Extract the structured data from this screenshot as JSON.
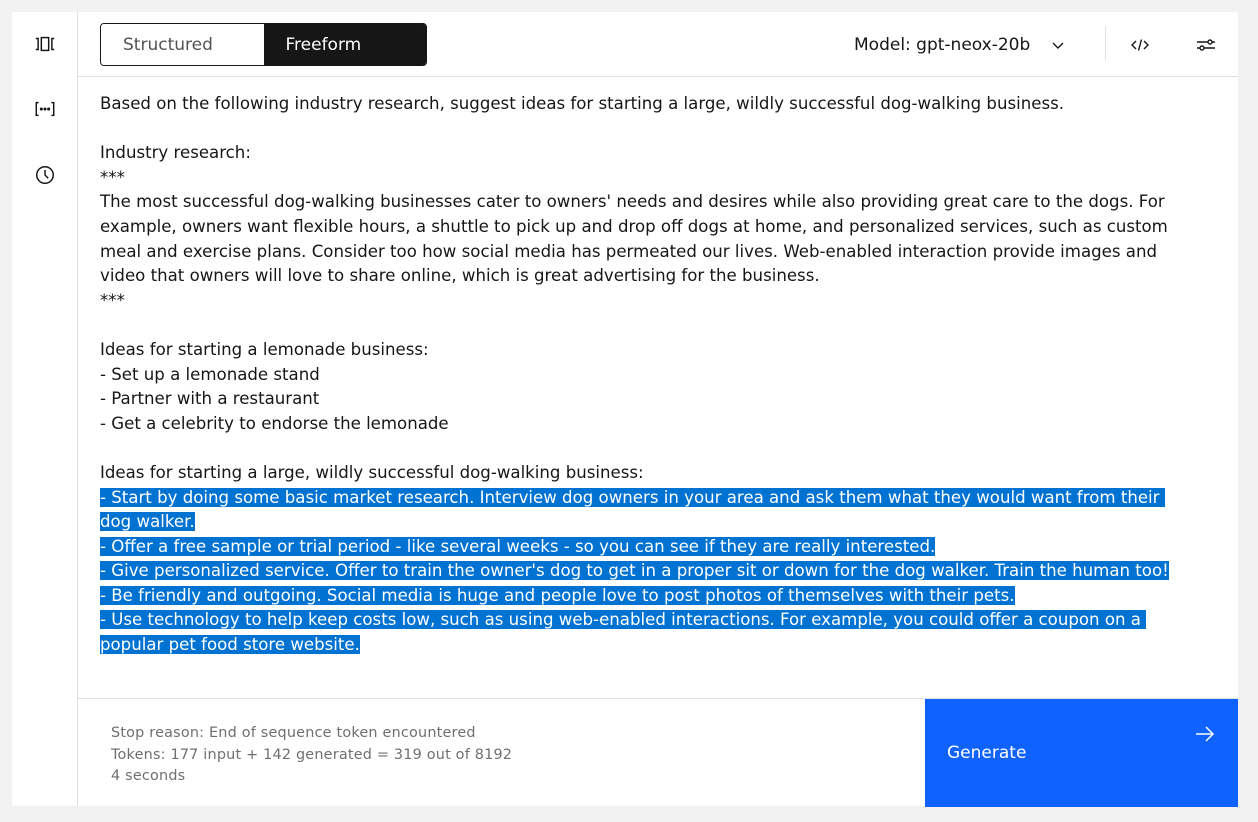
{
  "sidebar": {
    "items": [
      {
        "name": "carousel",
        "icon": "carousel-icon"
      },
      {
        "name": "variables",
        "icon": "bracket-dots-icon"
      },
      {
        "name": "history",
        "icon": "clock-icon"
      }
    ]
  },
  "header": {
    "mode_toggle": {
      "options": [
        "Structured",
        "Freeform"
      ],
      "selected": "Freeform"
    },
    "model": {
      "label": "Model: gpt-neox-20b",
      "icon": "chevron-down-icon"
    },
    "code_icon": "code-icon",
    "settings_icon": "sliders-icon"
  },
  "editor": {
    "prompt_lines": [
      "Based on the following industry research, suggest ideas for starting a large, wildly successful dog-walking business.",
      "",
      "Industry research:",
      "***",
      "The most successful dog-walking businesses cater to owners' needs and desires while also providing great care to the dogs. For example, owners want flexible hours, a shuttle to pick up and drop off dogs at home, and personalized services, such as custom meal and exercise plans. Consider too how social media has permeated our lives. Web-enabled interaction provide images and video that owners will love to share online, which is great advertising for the business.",
      "***",
      "",
      "Ideas for starting a lemonade business:",
      "- Set up a lemonade stand",
      "- Partner with a restaurant",
      "- Get a celebrity to endorse the lemonade",
      "",
      "Ideas for starting a large, wildly successful dog-walking business:"
    ],
    "generated_lines": [
      "- Start by doing some basic market research. Interview dog owners in your area and ask them what they would want from their dog walker.",
      "- Offer a free sample or trial period - like several weeks - so you can see if they are really interested.",
      "- Give personalized service. Offer to train the owner's dog to get in a proper sit or down for the dog walker. Train the human too!",
      "- Be friendly and outgoing. Social media is huge and people love to post photos of themselves with their pets.",
      "- Use technology to help keep costs low, such as using web-enabled interactions. For example, you could offer a coupon on a popular pet food store website."
    ]
  },
  "footer": {
    "stop_reason": "Stop reason: End of sequence token encountered",
    "tokens": "Tokens: 177 input + 142 generated = 319 out of 8192",
    "duration": "4 seconds",
    "generate_label": "Generate",
    "generate_icon": "arrow-right-icon"
  },
  "colors": {
    "accent": "#0f62fe",
    "selection": "#0072d2",
    "toggle_active": "#161616",
    "muted_text": "#6f6f6f"
  }
}
